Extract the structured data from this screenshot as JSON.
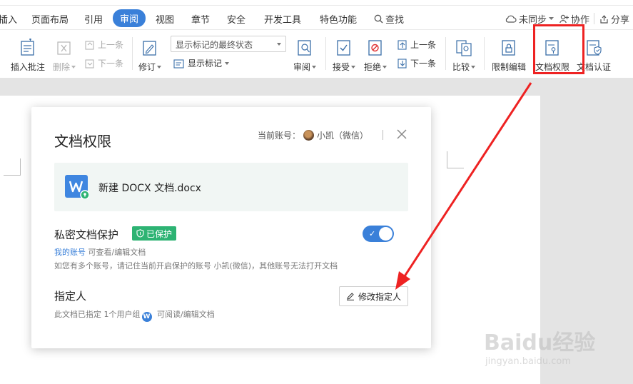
{
  "menubar": {
    "items": [
      "插入",
      "页面布局",
      "引用",
      "审阅",
      "视图",
      "章节",
      "安全",
      "开发工具",
      "特色功能"
    ],
    "active_index": 3,
    "search": "查找",
    "sync": "未同步",
    "collab": "协作",
    "share": "分享"
  },
  "toolbar": {
    "insert_comment": "插入批注",
    "delete": "删除",
    "prev_comment": "上一条",
    "next_comment": "下一条",
    "revise": "修订",
    "display_state": "显示标记的最终状态",
    "show_markup": "显示标记",
    "review": "审阅",
    "accept": "接受",
    "reject": "拒绝",
    "prev_change": "上一条",
    "next_change": "下一条",
    "compare": "比较",
    "restrict_edit": "限制编辑",
    "doc_permission": "文档权限",
    "doc_cert": "文档认证"
  },
  "dialog": {
    "title": "文档权限",
    "account_label": "当前账号：",
    "account_name": "小凯（微信）",
    "file_name": "新建 DOCX 文档.docx",
    "private_title": "私密文档保护",
    "protected_badge": "已保护",
    "my_account": "我的账号",
    "my_account_perm": "可查看/编辑文档",
    "multi_account_note": "如您有多个账号，请记住当前开启保护的账号 小凯(微信)，其他账号无法打开文档",
    "designee_title": "指定人",
    "designee_note_prefix": "此文档已指定",
    "designee_count": "1个用户组",
    "designee_perm": "可阅读/编辑文档",
    "edit_designee_button": "修改指定人",
    "toggle_on": true
  },
  "watermark": {
    "brand": "Baidu经验",
    "url": "jingyan.baidu.com"
  },
  "colors": {
    "accent": "#3a80d9",
    "protected_green": "#2db373",
    "annotation_red": "#ee2222"
  }
}
